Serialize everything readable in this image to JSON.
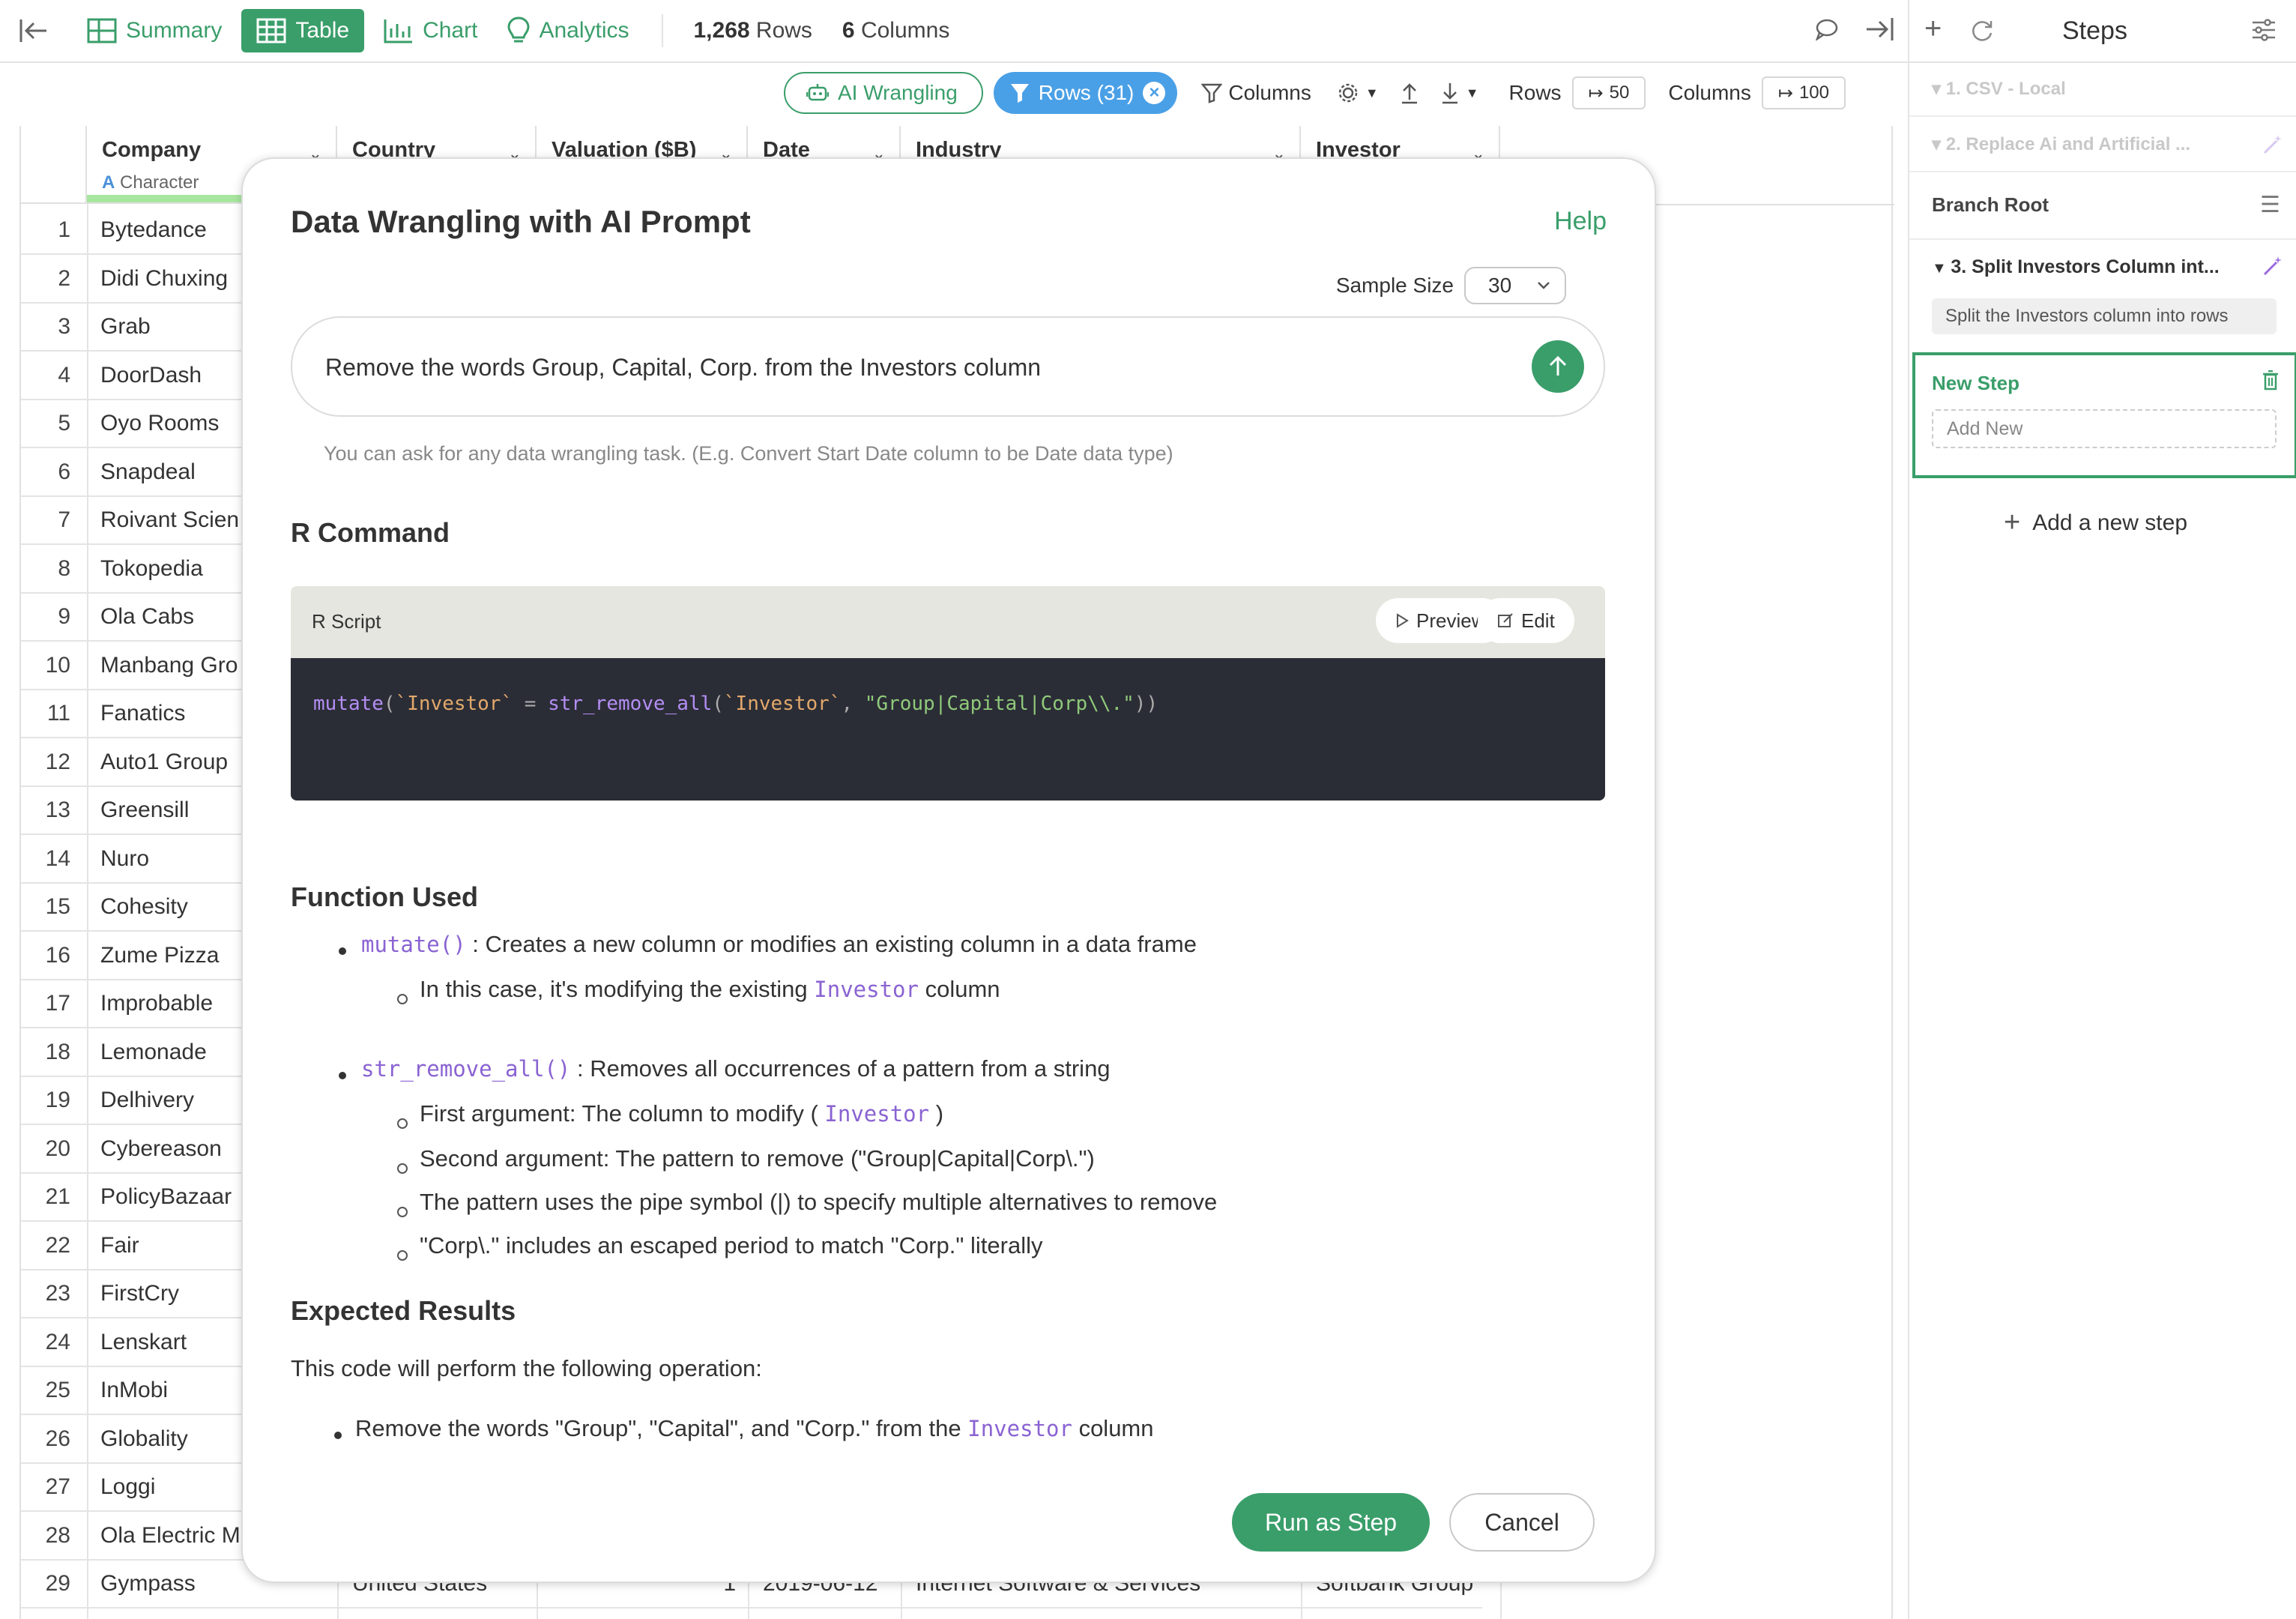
{
  "topbar": {
    "tabs": [
      {
        "label": "Summary",
        "icon": "summary-table-icon"
      },
      {
        "label": "Table",
        "icon": "table-grid-icon"
      },
      {
        "label": "Chart",
        "icon": "bar-chart-icon"
      },
      {
        "label": "Analytics",
        "icon": "lightbulb-icon"
      }
    ],
    "rows_count": "1,268",
    "rows_label": "Rows",
    "cols_count": "6",
    "cols_label": "Columns"
  },
  "toolbar2": {
    "ai_wrangling": "AI Wrangling",
    "rows_filter": "Rows (31)",
    "columns": "Columns",
    "rows_label": "Rows",
    "rows_value": "50",
    "columns_label": "Columns",
    "columns_value": "100"
  },
  "table": {
    "columns": [
      {
        "name": "Company",
        "type": "Character"
      },
      {
        "name": "Country"
      },
      {
        "name": "Valuation ($B)"
      },
      {
        "name": "Date"
      },
      {
        "name": "Industry"
      },
      {
        "name": "Investor"
      }
    ],
    "rows": [
      {
        "n": "1",
        "company": "Bytedance"
      },
      {
        "n": "2",
        "company": "Didi Chuxing"
      },
      {
        "n": "3",
        "company": "Grab"
      },
      {
        "n": "4",
        "company": "DoorDash"
      },
      {
        "n": "5",
        "company": "Oyo Rooms"
      },
      {
        "n": "6",
        "company": "Snapdeal"
      },
      {
        "n": "7",
        "company": "Roivant Scien"
      },
      {
        "n": "8",
        "company": "Tokopedia"
      },
      {
        "n": "9",
        "company": "Ola Cabs"
      },
      {
        "n": "10",
        "company": "Manbang Gro"
      },
      {
        "n": "11",
        "company": "Fanatics"
      },
      {
        "n": "12",
        "company": "Auto1 Group"
      },
      {
        "n": "13",
        "company": "Greensill"
      },
      {
        "n": "14",
        "company": "Nuro"
      },
      {
        "n": "15",
        "company": "Cohesity"
      },
      {
        "n": "16",
        "company": "Zume Pizza"
      },
      {
        "n": "17",
        "company": "Improbable"
      },
      {
        "n": "18",
        "company": "Lemonade"
      },
      {
        "n": "19",
        "company": "Delhivery"
      },
      {
        "n": "20",
        "company": "Cybereason"
      },
      {
        "n": "21",
        "company": "PolicyBazaar"
      },
      {
        "n": "22",
        "company": "Fair"
      },
      {
        "n": "23",
        "company": "FirstCry"
      },
      {
        "n": "24",
        "company": "Lenskart"
      },
      {
        "n": "25",
        "company": "InMobi"
      },
      {
        "n": "26",
        "company": "Globality"
      },
      {
        "n": "27",
        "company": "Loggi"
      },
      {
        "n": "28",
        "company": "Ola Electric M"
      },
      {
        "n": "29",
        "company": "Gympass",
        "country": "United States",
        "valuation": "1",
        "date": "2019-06-12",
        "industry": "Internet Software & Services",
        "investor": "Softbank Group"
      }
    ]
  },
  "modal": {
    "title": "Data Wrangling with AI Prompt",
    "help": "Help",
    "sample_size_label": "Sample Size",
    "sample_size_value": "30",
    "prompt": "Remove the words Group, Capital, Corp. from the Investors column",
    "hint": "You can ask for any data wrangling task. (E.g. Convert Start Date column to be Date data type)",
    "r_command_heading": "R Command",
    "r_script_label": "R Script",
    "preview": "Preview",
    "edit": "Edit",
    "code": {
      "fn1": "mutate",
      "p1": "(",
      "id1": "`Investor`",
      "eq": " = ",
      "fn2": "str_remove_all",
      "p2": "(",
      "id2": "`Investor`",
      "comma": ", ",
      "str": "\"Group|Capital|Corp\\\\.\"",
      "close": "))"
    },
    "function_used_heading": "Function Used",
    "fn_mutate": "mutate()",
    "fn_mutate_desc": " : Creates a new column or modifies an existing column in a data frame",
    "fn_mutate_sub_a": "In this case, it's modifying the existing ",
    "fn_mutate_sub_code": "Investor",
    "fn_mutate_sub_b": " column",
    "fn_remove": "str_remove_all()",
    "fn_remove_desc": " : Removes all occurrences of a pattern from a string",
    "sub1_a": "First argument: The column to modify ( ",
    "sub1_code": "Investor",
    "sub1_b": " )",
    "sub2": "Second argument: The pattern to remove (\"Group|Capital|Corp\\.\")",
    "sub3": "The pattern uses the pipe symbol (|) to specify multiple alternatives to remove",
    "sub4": "\"Corp\\.\" includes an escaped period to match \"Corp.\" literally",
    "expected_heading": "Expected Results",
    "expected_intro": "This code will perform the following operation:",
    "expected_a": "Remove the words \"Group\", \"Capital\", and \"Corp.\" from the ",
    "expected_code": "Investor",
    "expected_b": " column",
    "run_as_step": "Run as Step",
    "cancel": "Cancel"
  },
  "steps": {
    "title": "Steps",
    "step1": "1. CSV - Local",
    "step2": "2. Replace Ai and Artificial ...",
    "branch_root": "Branch Root",
    "step3": "3. Split Investors Column int...",
    "step3_desc": "Split the Investors column into rows",
    "new_step": "New Step",
    "add_new_placeholder": "Add New",
    "add_a_new_step": "Add a new step"
  },
  "colors": {
    "accent_green": "#3a9e6a",
    "filter_blue": "#4aa0e6",
    "code_bg": "#2b2d36"
  }
}
